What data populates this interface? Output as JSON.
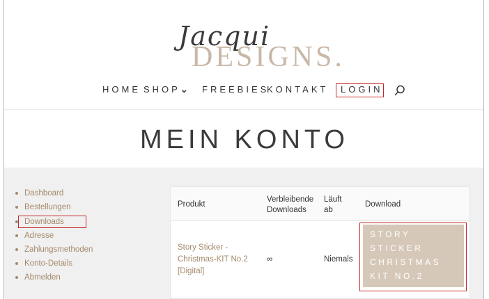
{
  "logo": {
    "script": "Jacqui",
    "main": "DESIGNS."
  },
  "nav": {
    "home": "HOME",
    "shop": "SHOP",
    "shop_chevron": "⌄",
    "freebies": "FREEBIES",
    "kontakt": "KONTAKT",
    "login": "LOGIN"
  },
  "page": {
    "title": "MEIN KONTO"
  },
  "account_nav": [
    {
      "label": "Dashboard"
    },
    {
      "label": "Bestellungen"
    },
    {
      "label": "Downloads"
    },
    {
      "label": "Adresse"
    },
    {
      "label": "Zahlungsmethoden"
    },
    {
      "label": "Konto-Details"
    },
    {
      "label": "Abmelden"
    }
  ],
  "table": {
    "headers": {
      "produkt": "Produkt",
      "verbleibende": "Verbleibende Downloads",
      "laeuft": "Läuft ab",
      "download": "Download"
    },
    "rows": [
      {
        "produkt": "Story Sticker - Christmas-KIT No.2 [Digital]",
        "verbleibende": "∞",
        "laeuft": "Niemals",
        "download": "STORY STICKER CHRISTMAS KIT NO.2"
      }
    ]
  },
  "colors": {
    "accent": "#a5896a",
    "button": "#d6c8b8",
    "highlight": "#c62828"
  }
}
